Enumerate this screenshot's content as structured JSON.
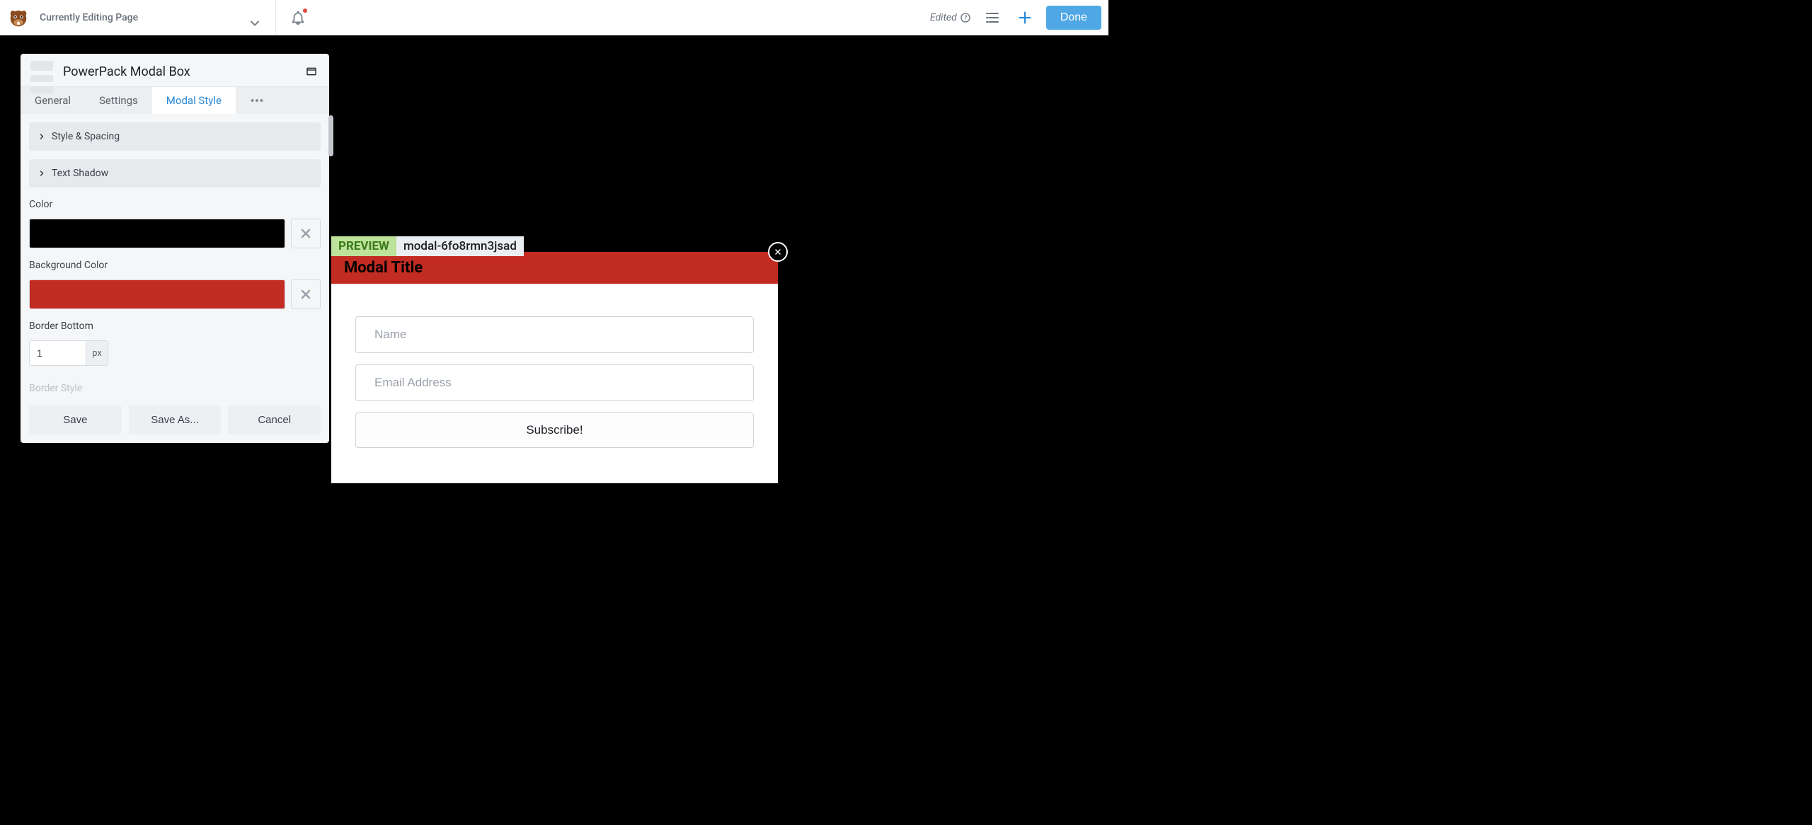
{
  "topbar": {
    "page_title": "Currently Editing Page",
    "edited_label": "Edited",
    "done_label": "Done"
  },
  "panel": {
    "title": "PowerPack Modal Box",
    "tabs": {
      "general": "General",
      "settings": "Settings",
      "modal_style": "Modal Style"
    },
    "accordions": {
      "style_spacing": "Style & Spacing",
      "text_shadow": "Text Shadow"
    },
    "fields": {
      "color_label": "Color",
      "color_value": "#000000",
      "bg_color_label": "Background Color",
      "bg_color_value": "#C32C22",
      "border_bottom_label": "Border Bottom",
      "border_bottom_value": "1",
      "border_bottom_unit": "px",
      "border_style_label": "Border Style"
    },
    "footer": {
      "save": "Save",
      "save_as": "Save As...",
      "cancel": "Cancel"
    }
  },
  "preview": {
    "badge": "PREVIEW",
    "id": "modal-6fo8rmn3jsad"
  },
  "modal": {
    "title": "Modal Title",
    "name_placeholder": "Name",
    "email_placeholder": "Email Address",
    "subscribe_label": "Subscribe!"
  }
}
